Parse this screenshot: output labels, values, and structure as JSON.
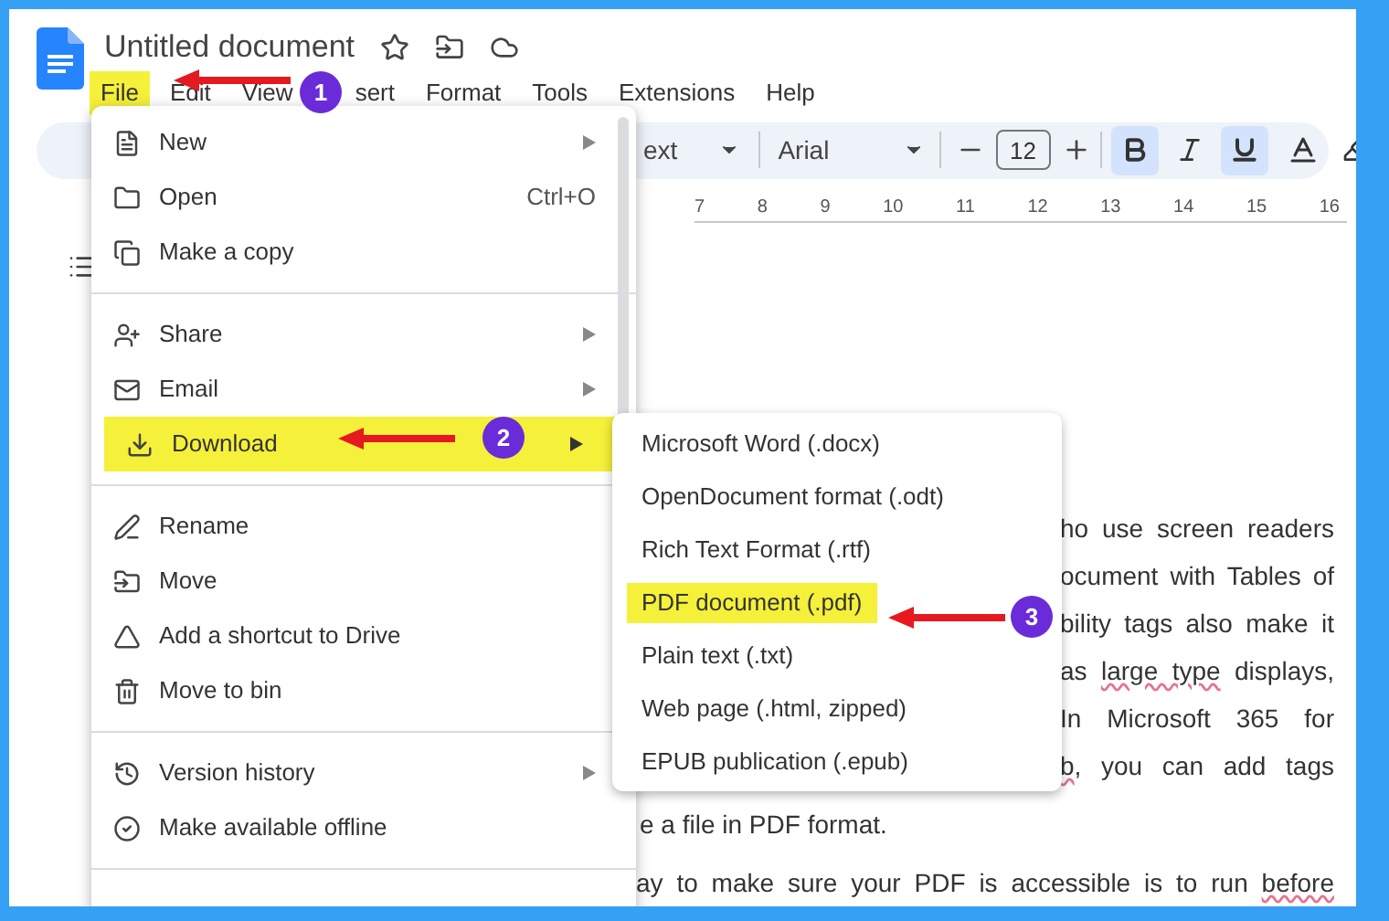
{
  "app": {
    "title": "Untitled document"
  },
  "menu_bar": [
    {
      "label": "File",
      "selected": true
    },
    {
      "label": "Edit",
      "selected": false
    },
    {
      "label": "View",
      "selected": false
    },
    {
      "label": "sert",
      "selected": false
    },
    {
      "label": "Format",
      "selected": false
    },
    {
      "label": "Tools",
      "selected": false
    },
    {
      "label": "Extensions",
      "selected": false
    },
    {
      "label": "Help",
      "selected": false
    }
  ],
  "toolbar": {
    "style_partial": "ext",
    "font": "Arial",
    "font_size": "12",
    "bold": true,
    "italic": false,
    "underline": true
  },
  "ruler": [
    "7",
    "8",
    "9",
    "10",
    "11",
    "12",
    "13",
    "14",
    "15",
    "16"
  ],
  "file_menu": [
    {
      "kind": "item",
      "label": "New",
      "submenu": true,
      "highlighted": false
    },
    {
      "kind": "item",
      "label": "Open",
      "shortcut": "Ctrl+O",
      "submenu": false,
      "highlighted": false
    },
    {
      "kind": "item",
      "label": "Make a copy",
      "submenu": false,
      "highlighted": false
    },
    {
      "kind": "divider"
    },
    {
      "kind": "item",
      "label": "Share",
      "submenu": true,
      "highlighted": false
    },
    {
      "kind": "item",
      "label": "Email",
      "submenu": true,
      "highlighted": false
    },
    {
      "kind": "item",
      "label": "Download",
      "submenu": true,
      "highlighted": true
    },
    {
      "kind": "divider"
    },
    {
      "kind": "item",
      "label": "Rename",
      "submenu": false,
      "highlighted": false
    },
    {
      "kind": "item",
      "label": "Move",
      "submenu": false,
      "highlighted": false
    },
    {
      "kind": "item",
      "label": "Add a shortcut to Drive",
      "submenu": false,
      "highlighted": false
    },
    {
      "kind": "item",
      "label": "Move to bin",
      "submenu": false,
      "highlighted": false
    },
    {
      "kind": "divider"
    },
    {
      "kind": "item",
      "label": "Version history",
      "submenu": true,
      "highlighted": false
    },
    {
      "kind": "item",
      "label": "Make available offline",
      "submenu": false,
      "highlighted": false
    },
    {
      "kind": "divider"
    }
  ],
  "download_submenu": [
    {
      "label": "Microsoft Word (.docx)",
      "highlighted": false
    },
    {
      "label": "OpenDocument format (.odt)",
      "highlighted": false
    },
    {
      "label": "Rich Text Format (.rtf)",
      "highlighted": false
    },
    {
      "label": "PDF document (.pdf)",
      "highlighted": true
    },
    {
      "label": "Plain text (.txt)",
      "highlighted": false
    },
    {
      "label": "Web page (.html, zipped)",
      "highlighted": false
    },
    {
      "label": "EPUB publication (.epub)",
      "highlighted": false
    }
  ],
  "document_lines": [
    {
      "kind": "narrow",
      "parts": [
        {
          "text": "ho use screen readers",
          "flagged": false
        }
      ]
    },
    {
      "kind": "narrow",
      "parts": [
        {
          "text": "ocument with Tables of",
          "flagged": false
        }
      ]
    },
    {
      "kind": "narrow",
      "parts": [
        {
          "text": "bility tags also make it",
          "flagged": false
        }
      ]
    },
    {
      "kind": "narrow",
      "parts": [
        {
          "text": "as ",
          "flagged": false
        },
        {
          "text": "large type",
          "flagged": true
        },
        {
          "text": " displays,",
          "flagged": false
        }
      ]
    },
    {
      "kind": "narrow",
      "parts": [
        {
          "text": "In Microsoft 365 for",
          "flagged": false
        }
      ]
    },
    {
      "kind": "narrow",
      "parts": [
        {
          "text": "b",
          "flagged": true
        },
        {
          "text": ", you can add tags",
          "flagged": false
        }
      ]
    },
    {
      "kind": "plain",
      "parts": [
        {
          "text": "e a file in PDF format.",
          "flagged": false
        }
      ]
    },
    {
      "kind": "wide",
      "parts": [
        {
          "text": "ay to make sure your PDF is accessible is to run ",
          "flagged": false
        },
        {
          "text": "before",
          "flagged": true
        }
      ]
    }
  ],
  "annotations": [
    {
      "number": "1"
    },
    {
      "number": "2"
    },
    {
      "number": "3"
    }
  ]
}
